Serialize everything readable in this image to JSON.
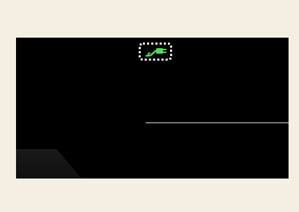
{
  "screen": {
    "background": "#000000",
    "accent_color": "#52d85c",
    "page_background": "#f5efe3"
  },
  "plug_indicator": {
    "icon": "plug-icon"
  }
}
